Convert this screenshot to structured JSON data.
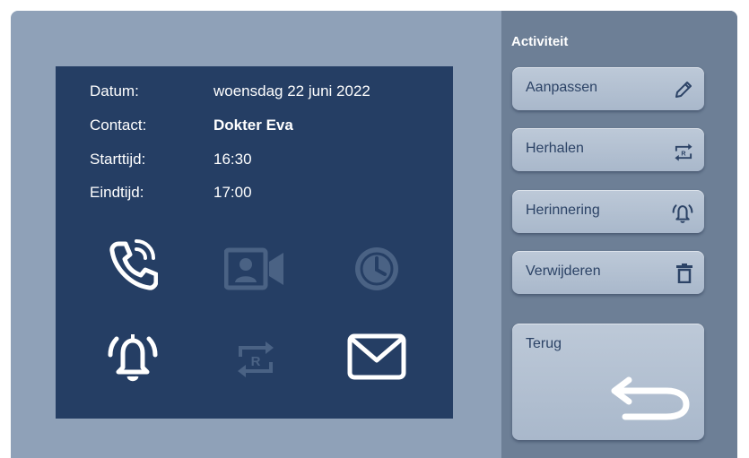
{
  "info": {
    "rows": [
      {
        "label": "Datum:",
        "value": "woensdag 22 juni 2022"
      },
      {
        "label": "Contact:",
        "value": "Dokter Eva"
      },
      {
        "label": "Starttijd:",
        "value": "16:30"
      },
      {
        "label": "Eindtijd:",
        "value": "17:00"
      }
    ]
  },
  "icons": {
    "phone": "phone-call-icon",
    "video": "video-call-icon",
    "clock": "clock-icon",
    "alarm": "alarm-bell-icon",
    "repeat": "repeat-icon",
    "mail": "mail-icon"
  },
  "panel": {
    "title": "Activiteit",
    "buttons": [
      {
        "label": "Aanpassen",
        "icon": "pencil-icon"
      },
      {
        "label": "Herhalen",
        "icon": "repeat-icon"
      },
      {
        "label": "Herinnering",
        "icon": "alarm-bell-icon"
      },
      {
        "label": "Verwijderen",
        "icon": "trash-icon"
      },
      {
        "label": "Terug",
        "icon": "return-arrow-icon"
      }
    ]
  },
  "colors": {
    "device": "#8fa1b8",
    "panel": "#6d7f96",
    "screen": "#253e64",
    "button": "#b3c1d2",
    "icon_active": "#ffffff",
    "icon_inactive": "#4a6284"
  }
}
